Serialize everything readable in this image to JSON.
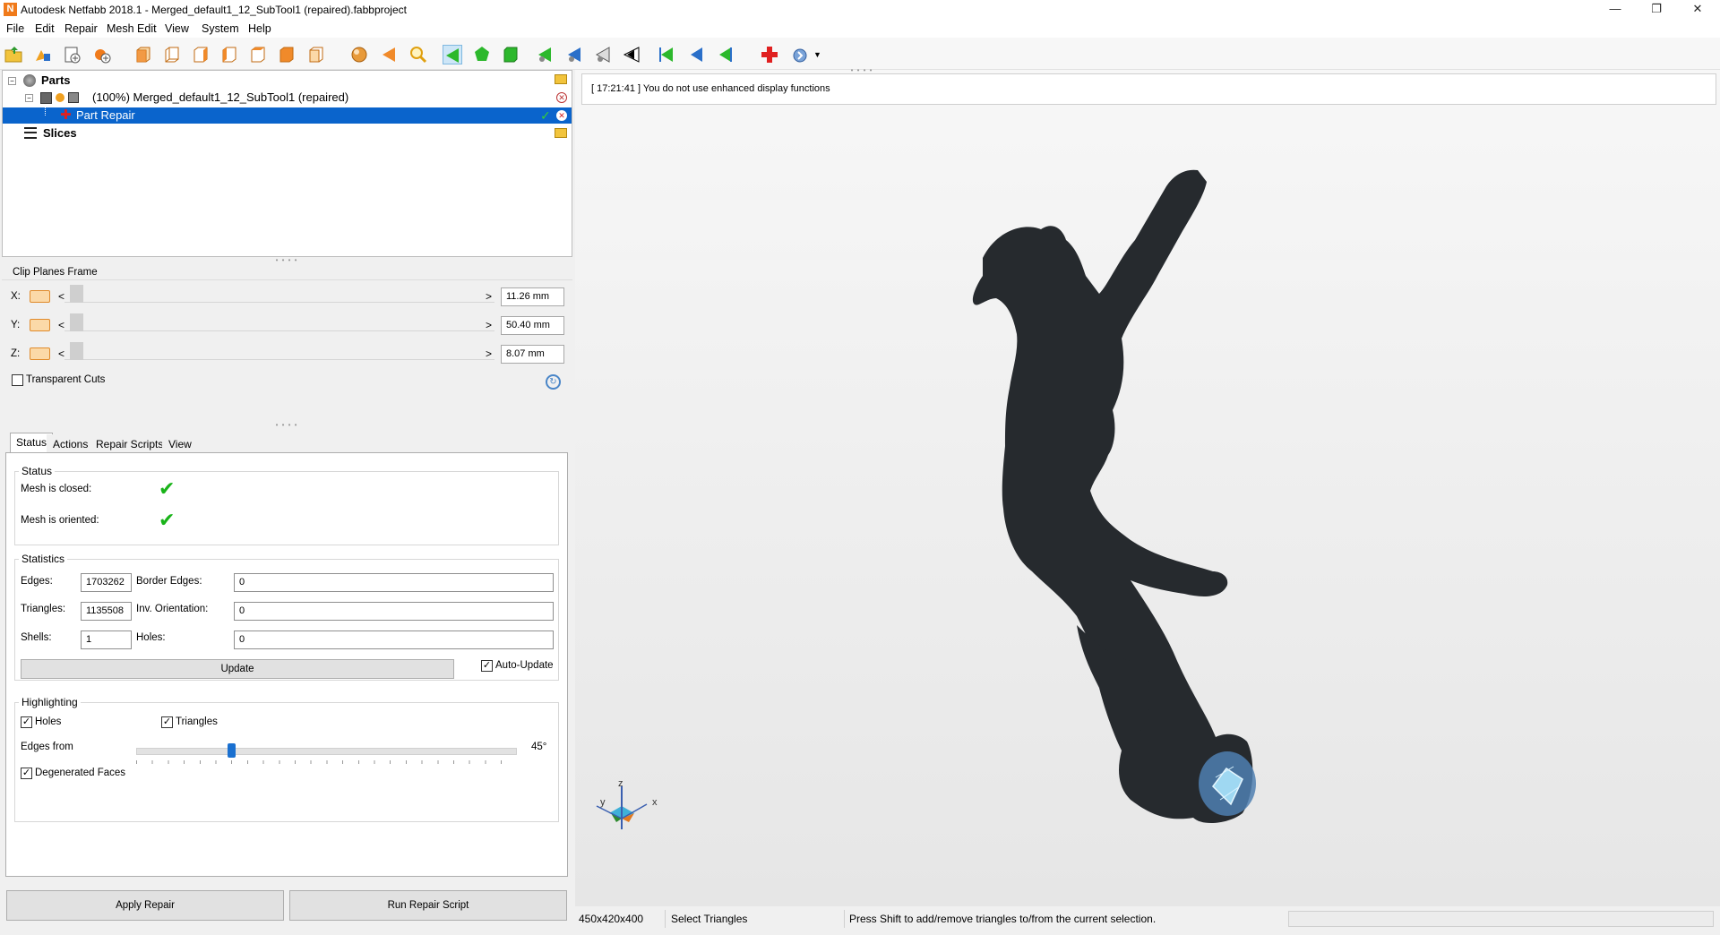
{
  "window": {
    "title": "Autodesk Netfabb 2018.1 - Merged_default1_12_SubTool1 (repaired).fabbproject",
    "app_icon_letter": "N",
    "minimize": "—",
    "restore": "❐",
    "close": "✕"
  },
  "menu": [
    "File",
    "Edit",
    "Repair",
    "Mesh Edit",
    "View",
    "System",
    "Help"
  ],
  "tree": {
    "parts_label": "Parts",
    "part_label": "(100%) Merged_default1_12_SubTool1 (repaired)",
    "repair_label": "Part Repair",
    "slices_label": "Slices"
  },
  "clip": {
    "title": "Clip Planes Frame",
    "x_label": "X:",
    "y_label": "Y:",
    "z_label": "Z:",
    "x_value": "11.26 mm",
    "y_value": "50.40 mm",
    "z_value": "8.07 mm",
    "left_arrow": "<",
    "right_arrow": ">",
    "transparent_cuts": "Transparent Cuts",
    "transparent_checked": false
  },
  "tabs": [
    "Status",
    "Actions",
    "Repair Scripts",
    "View"
  ],
  "status": {
    "group_title": "Status",
    "mesh_closed": "Mesh is closed:",
    "mesh_oriented": "Mesh is oriented:",
    "mark": "✔"
  },
  "statistics": {
    "group_title": "Statistics",
    "edges_label": "Edges:",
    "edges_value": "1703262",
    "border_edges_label": "Border Edges:",
    "border_edges_value": "0",
    "triangles_label": "Triangles:",
    "triangles_value": "1135508",
    "inv_orientation_label": "Inv. Orientation:",
    "inv_orientation_value": "0",
    "shells_label": "Shells:",
    "shells_value": "1",
    "holes_label": "Holes:",
    "holes_value": "0",
    "update_label": "Update",
    "auto_update_label": "Auto-Update",
    "auto_update_checked": true
  },
  "highlighting": {
    "group_title": "Highlighting",
    "holes_label": "Holes",
    "triangles_label": "Triangles",
    "edges_from_label": "Edges from",
    "edges_from_value": "45°",
    "edges_from_fraction": 0.25,
    "degenerated_label": "Degenerated Faces",
    "holes_checked": true,
    "triangles_checked": true,
    "degenerated_checked": true
  },
  "buttons": {
    "apply_repair": "Apply Repair",
    "run_repair_script": "Run Repair Script"
  },
  "viewport": {
    "message": "[ 17:21:41 ] You do not use enhanced display functions",
    "axis_x": "x",
    "axis_y": "y",
    "axis_z": "z"
  },
  "statusbar": {
    "dimensions": "450x420x400",
    "mode": "Select Triangles",
    "hint": "Press Shift to add/remove triangles to/from the current selection."
  },
  "colors": {
    "selection": "#0a64cc",
    "check_green": "#19b319",
    "model": "#262a2e",
    "selected_triangles": "#9fd8f2"
  },
  "icons": {
    "ok": "✔",
    "remove": "✕",
    "check": "✓"
  }
}
